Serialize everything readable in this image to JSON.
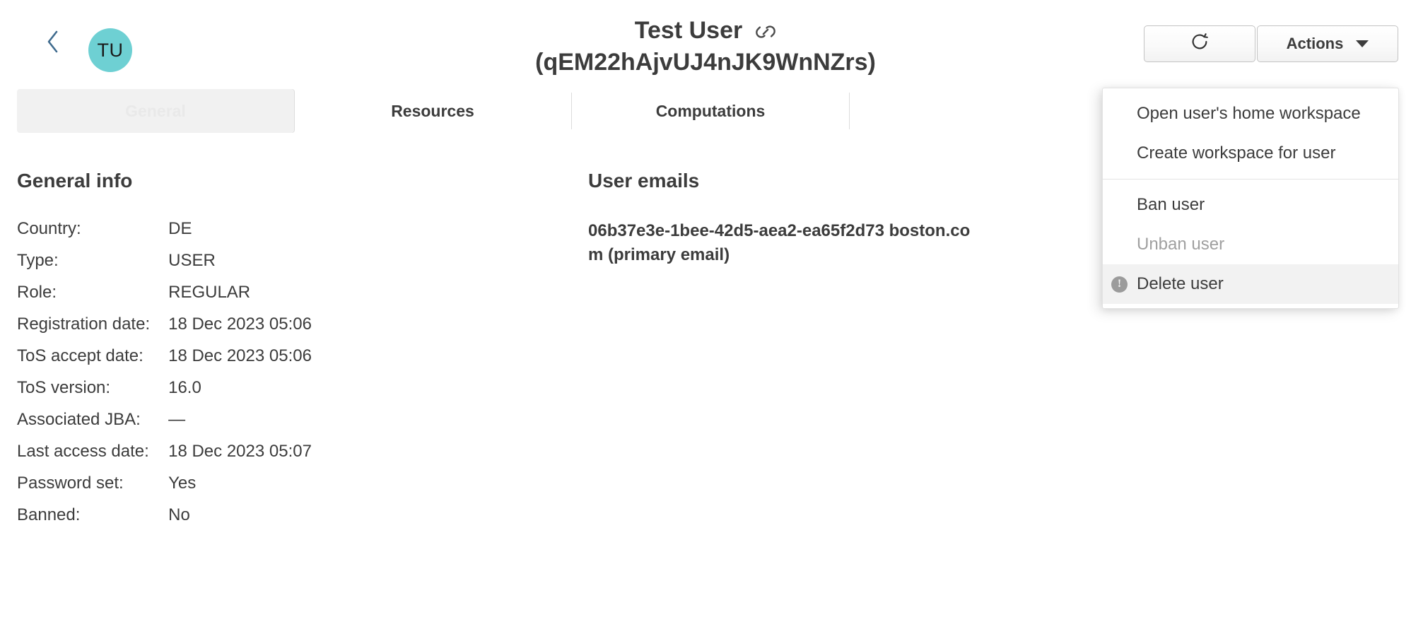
{
  "header": {
    "back_icon": "chevron-left-icon",
    "avatar_initials": "TU",
    "avatar_color": "#6ed0d3",
    "title_name": "Test User",
    "title_id": "(qEM22hAjvUJ4nJK9WnNZrs)",
    "link_icon": "link-icon",
    "refresh_icon": "refresh-icon",
    "refresh_label": "",
    "actions_label": "Actions",
    "caret_icon": "chevron-down-icon"
  },
  "actions_menu": {
    "items": [
      {
        "label": "Open user's home workspace",
        "state": "enabled",
        "icon": ""
      },
      {
        "label": "Create workspace for user",
        "state": "enabled",
        "icon": ""
      },
      {
        "label": "Ban user",
        "state": "enabled",
        "icon": ""
      },
      {
        "label": "Unban user",
        "state": "disabled",
        "icon": ""
      },
      {
        "label": "Delete user",
        "state": "highlighted",
        "icon": "warning-circle-icon"
      }
    ]
  },
  "tabs": [
    {
      "label": "General",
      "active": true
    },
    {
      "label": "Resources",
      "active": false
    },
    {
      "label": "Computations",
      "active": false
    },
    {
      "label": "",
      "active": false
    }
  ],
  "general_info": {
    "heading": "General info",
    "rows": [
      {
        "label": "Country:",
        "value": "DE"
      },
      {
        "label": "Type:",
        "value": "USER"
      },
      {
        "label": "Role:",
        "value": "REGULAR"
      },
      {
        "label": "Registration date:",
        "value": "18 Dec 2023 05:06"
      },
      {
        "label": "ToS accept date:",
        "value": "18 Dec 2023 05:06"
      },
      {
        "label": "ToS version:",
        "value": "16.0"
      },
      {
        "label": "Associated JBA:",
        "value": "—"
      },
      {
        "label": "Last access date:",
        "value": "18 Dec 2023 05:07"
      },
      {
        "label": "Password set:",
        "value": "Yes"
      },
      {
        "label": "Banned:",
        "value": "No"
      }
    ]
  },
  "user_emails": {
    "heading": "User emails",
    "entries": [
      "06b37e3e-1bee-42d5-aea2-ea65f2d73 boston.com (primary email)"
    ]
  }
}
